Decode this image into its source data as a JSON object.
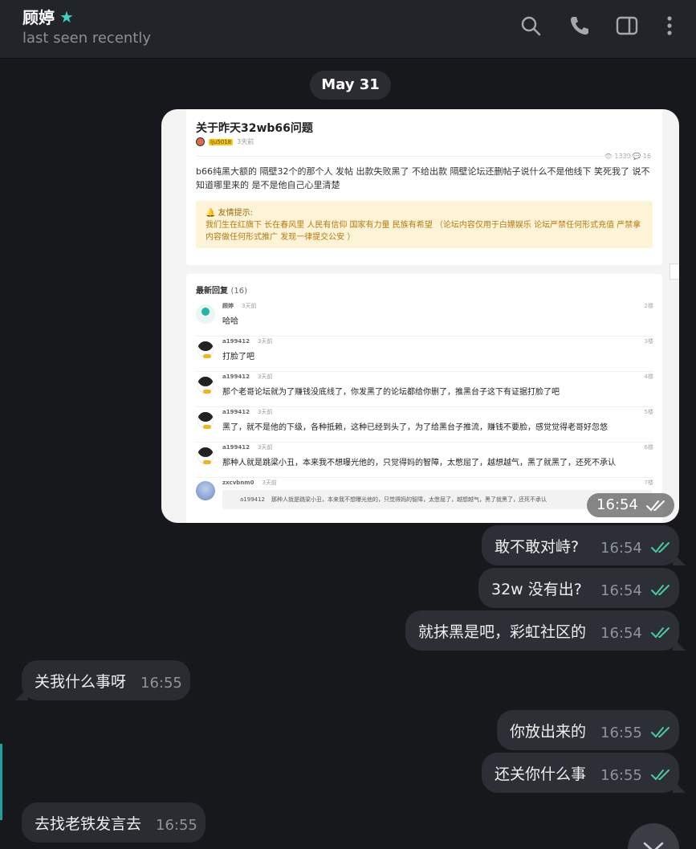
{
  "header": {
    "title": "顾婷",
    "subtitle": "last seen recently",
    "star_icon": "star-icon",
    "actions": [
      "search-icon",
      "phone-icon",
      "sidebar-toggle-icon",
      "more-vertical-icon"
    ]
  },
  "date_chip": "May 31",
  "image_message": {
    "time": "16:54",
    "screenshot": {
      "post_title": "关于昨天32wb66问题",
      "post_author_tag": "lju5018",
      "post_time": "3天前",
      "post_stats": "👁 1339  💬 16",
      "post_body": "b66纯黑大额的 隔壁32个的那个人 发帖 出款失败黑了 不给出款 隔壁论坛还删帖子说什么不是他线下 笑死我了 说不知道哪里来的 是不是他自己心里清楚",
      "notice_title": "🔔 友情提示:",
      "notice_body": "我们生在红旗下 长在春风里 人民有信仰 国家有力量 民族有希望 （论坛内容仅用于白嫖娱乐 论坛严禁任何形式充值 严禁拿内容做任何形式推广 发现一律提交公安 ）",
      "replies_header": "最新回复",
      "replies_count": "(16)",
      "replies": [
        {
          "user": "顾婷",
          "time": "3天前",
          "floor": "2楼",
          "text": "哈哈"
        },
        {
          "user": "a199412",
          "time": "3天前",
          "floor": "3楼",
          "text": "打脸了吧"
        },
        {
          "user": "a199412",
          "time": "3天前",
          "floor": "4楼",
          "text": "那个老哥论坛就为了赚钱没底线了，你发黑了的论坛都给你删了，推黑台子这下有证据打脸了吧"
        },
        {
          "user": "a199412",
          "time": "3天前",
          "floor": "5楼",
          "text": "黑了，就不是他的下级，各种抵赖，这种已经到头了，为了给黑台子推流，赚钱不要脸，感觉觉得老哥好忽悠"
        },
        {
          "user": "a199412",
          "time": "3天前",
          "floor": "6楼",
          "text": "那种人就是跳梁小丑，本来我不想曝光他的，只觉得妈的智障，太憋屈了，越想越气，黑了就黑了，还死不承认"
        },
        {
          "user": "zxcvbnm0",
          "time": "3天前",
          "floor": "7楼",
          "quote_user": "a199412",
          "quote": "那种人就是跳梁小丑，本来我不想曝光他的，只觉得妈的智障，太憋屈了，越想越气，黑了就黑了，还死不承认"
        }
      ]
    }
  },
  "messages": [
    {
      "direction": "out",
      "text": "敢不敢对峙?",
      "time": "16:54",
      "status": "read"
    },
    {
      "direction": "out",
      "text": "32w 没有出?",
      "time": "16:54",
      "status": "read"
    },
    {
      "direction": "out",
      "text": "就抹黑是吧，彩虹社区的",
      "time": "16:54",
      "status": "read"
    },
    {
      "direction": "in",
      "text": "关我什么事呀",
      "time": "16:55"
    },
    {
      "direction": "out",
      "text": "你放出来的",
      "time": "16:55",
      "status": "read"
    },
    {
      "direction": "out",
      "text": "还关你什么事",
      "time": "16:55",
      "status": "read"
    },
    {
      "direction": "in",
      "text": "去找老铁发言去",
      "time": "16:55"
    }
  ],
  "colors": {
    "background": "#17181c",
    "header": "#212429",
    "bubble": "#2c2f35",
    "accent": "#3fd0c0",
    "read_check": "#4cc9a0"
  }
}
